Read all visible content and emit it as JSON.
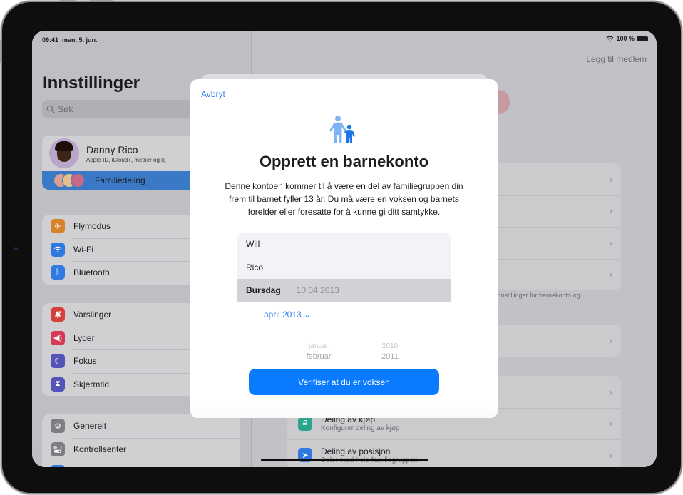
{
  "status_bar": {
    "time": "09:41",
    "date": "man. 5. jun.",
    "battery": "100 %",
    "icons": [
      "wifi-icon",
      "battery-icon"
    ]
  },
  "sidebar": {
    "title": "Innstillinger",
    "search_placeholder": "Søk",
    "profile": {
      "name": "Danny Rico",
      "subtitle": "Apple-ID, iCloud+, medier og kj"
    },
    "family_sharing": {
      "label": "Familiedeling",
      "selected": true
    },
    "groups": [
      {
        "items": [
          {
            "label": "Flymodus",
            "icon": "airplane-icon",
            "color": "#d8822b"
          },
          {
            "label": "Wi-Fi",
            "icon": "wifi-icon",
            "color": "#2f7ae0"
          },
          {
            "label": "Bluetooth",
            "icon": "bluetooth-icon",
            "color": "#2f7ae0"
          }
        ]
      },
      {
        "items": [
          {
            "label": "Varslinger",
            "icon": "notifications-icon",
            "color": "#d6403a"
          },
          {
            "label": "Lyder",
            "icon": "speaker-icon",
            "color": "#d43a55"
          },
          {
            "label": "Fokus",
            "icon": "moon-icon",
            "color": "#5353b8"
          },
          {
            "label": "Skjermtid",
            "icon": "hourglass-icon",
            "color": "#5353b8"
          }
        ]
      },
      {
        "items": [
          {
            "label": "Generelt",
            "icon": "gear-icon",
            "color": "#7d7d82"
          },
          {
            "label": "Kontrollsenter",
            "icon": "toggles-icon",
            "color": "#7d7d82"
          }
        ]
      }
    ]
  },
  "detail": {
    "add_member": "Legg til medlem",
    "footnote": "er innstillinger for barnekonto og",
    "rows": [
      {
        "title": "Deling av kjøp",
        "subtitle": "Konfigurer deling av kjøp",
        "icon": "purchase-sharing-icon",
        "color": "#2aa58f"
      },
      {
        "title": "Deling av posisjon",
        "subtitle": "Deler med hele familiegruppen",
        "icon": "location-icon",
        "color": "#2f7ae0"
      }
    ]
  },
  "sheet": {
    "cancel": "Avbryt",
    "title": "Opprett en barnekonto",
    "description": "Denne kontoen kommer til å være en del av familiegruppen din frem til barnet fyller 13 år.  Du må være en voksen og barnets forelder eller foresatte for å kunne gi ditt samtykke.",
    "form": {
      "first_name": "Will",
      "last_name": "Rico",
      "birthday_label": "Bursdag",
      "birthday_value": "10.04.2013"
    },
    "month_picker": "april 2013",
    "wheel": {
      "months": [
        "januar",
        "februar"
      ],
      "years": [
        "2010",
        "2011"
      ]
    },
    "verify_button": "Verifiser at du er voksen"
  }
}
